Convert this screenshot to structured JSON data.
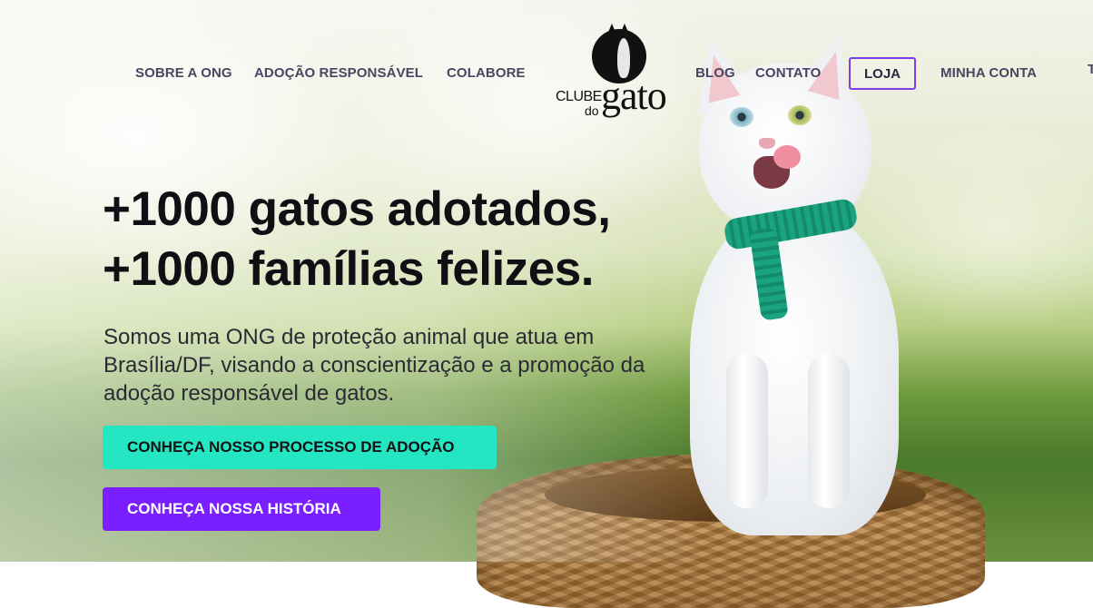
{
  "nav": {
    "left": [
      "SOBRE A ONG",
      "ADOÇÃO RESPONSÁVEL",
      "COLABORE"
    ],
    "right": [
      "BLOG",
      "CONTATO"
    ],
    "loja": "LOJA",
    "account": "MINHA CONTA",
    "overflow": "T"
  },
  "logo": {
    "clube": "CLUBE",
    "do": "do",
    "gato": "gato"
  },
  "hero": {
    "title_line1": "+1000 gatos adotados,",
    "title_line2": "+1000 famílias felizes.",
    "description": "Somos uma ONG de proteção animal que atua em Brasília/DF, visando a conscientização e a promoção da adoção responsável de gatos."
  },
  "buttons": {
    "adocao": "CONHEÇA NOSSO PROCESSO DE ADOÇÃO",
    "historia": "CONHEÇA NOSSA HISTÓRIA"
  },
  "colors": {
    "accent_teal": "#25e6c3",
    "accent_purple": "#7a1fff",
    "nav_text": "#4a4560"
  }
}
